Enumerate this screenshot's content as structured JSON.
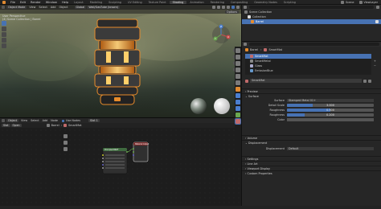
{
  "topbar": {
    "menus": [
      "File",
      "Edit",
      "Render",
      "Window",
      "Help"
    ],
    "workspaces": [
      {
        "label": "Layout",
        "active": false
      },
      {
        "label": "Modeling",
        "active": false
      },
      {
        "label": "Sculpting",
        "active": false
      },
      {
        "label": "UV Editing",
        "active": false
      },
      {
        "label": "Texture Paint",
        "active": false
      },
      {
        "label": "Shading",
        "active": true
      },
      {
        "label": "Animation",
        "active": false
      },
      {
        "label": "Rendering",
        "active": false
      },
      {
        "label": "Compositing",
        "active": false
      },
      {
        "label": "Geometry Nodes",
        "active": false
      },
      {
        "label": "Scripting",
        "active": false
      }
    ],
    "scene": "Scene",
    "view_layer": "ViewLayer"
  },
  "viewport": {
    "mode": "Object Mode",
    "menus": [
      "View",
      "Select",
      "Add",
      "Object"
    ],
    "shading_label": "Global",
    "hdri_label": "Wall/GasTube (brown)",
    "overlay_title": "User Perspective",
    "overlay_sub": "(4) Scene Collection | Barrel",
    "options_label": "Options",
    "axes": {
      "x": "X",
      "y": "Y",
      "z": "Z"
    }
  },
  "node_editor": {
    "type_label": "Object",
    "menus": [
      "View",
      "Select",
      "Add",
      "Node"
    ],
    "use_nodes_label": "Use Nodes",
    "slot_label": "Slot 1",
    "breadcrumb": [
      "Barrel",
      "SmartMat"
    ],
    "left_labels": [
      "Slot",
      "Open"
    ],
    "node_a_title": "Principled BSDF",
    "node_b_title": "Material Output"
  },
  "outliner": {
    "search_placeholder": "",
    "items": [
      {
        "label": "Scene Collection",
        "depth": 0
      },
      {
        "label": "Collection",
        "depth": 1
      },
      {
        "label": "Barrel",
        "depth": 2,
        "selected": true
      }
    ]
  },
  "properties": {
    "breadcrumb": [
      "Barrel",
      "SmartMat"
    ],
    "materials": [
      {
        "label": "SmartMat",
        "selected": true
      },
      {
        "label": "SmartMetal",
        "selected": false
      },
      {
        "label": "Glass",
        "selected": false
      },
      {
        "label": "EmissionBlue",
        "selected": false
      }
    ],
    "material_name": "SmartMat",
    "sections": {
      "preview": "Preview",
      "surface": "Surface",
      "volume": "Volume",
      "displacement": "Displacement",
      "settings": "Settings",
      "line_art": "Line Art",
      "viewport_display": "Viewport Display",
      "custom_properties": "Custom Properties"
    },
    "surface_label": "Surface",
    "surface_value": "Stamped Metal 01+",
    "fields": [
      {
        "label": "Detail Scale",
        "value": "3.000",
        "fill": 0.3
      },
      {
        "label": "Roughness",
        "value": "0.500",
        "fill": 0.5
      },
      {
        "label": "Roughness",
        "value": "0.200",
        "fill": 0.2
      },
      {
        "label": "Color",
        "value": "",
        "fill": 0
      }
    ],
    "displacement_label": "Displacement",
    "displacement_value": "Default"
  },
  "colors": {
    "accent": "#4772b3",
    "selection_orange": "#e78b2b",
    "glow": "#ffb347"
  }
}
